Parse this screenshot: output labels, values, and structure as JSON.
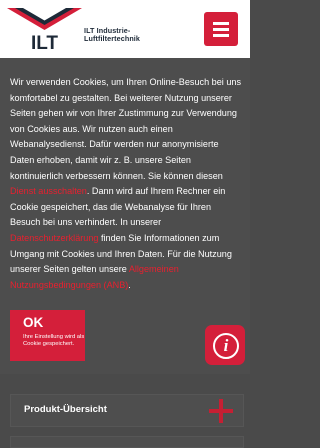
{
  "header": {
    "brand_line1": "ILT Industrie-",
    "brand_line2": "Luftfiltertechnik",
    "logo_letters": "ILT"
  },
  "cookie": {
    "text_1": "Wir verwenden Cookies, um Ihren Online-Besuch bei uns komfortabel zu gestalten. Bei weiterer Nutzung unserer Seiten gehen wir von Ihrer Zustimmung zur Verwendung von Cookies aus. Wir nutzen auch einen Webanalysedienst. Dafür werden nur anonymisierte Daten erhoben, damit wir z. B. unsere Seiten kontinuierlich verbessern können. Sie können diesen ",
    "link_disable": "Dienst ausschalten",
    "text_2": ". Dann wird auf Ihrem Rechner ein Cookie gespeichert, das die Webanalyse für Ihren Besuch bei uns verhindert. In unserer ",
    "link_privacy": "Datenschutzerklärung",
    "text_3": " finden Sie Informationen zum Umgang mit Cookies und Ihren Daten. Für die Nutzung unserer Seiten gelten unsere ",
    "link_terms": "Allgemeinen Nutzungsbedingungen (ANB)",
    "text_4": ".",
    "ok_label": "OK",
    "ok_sub": "Ihre Einstellung wird als Cookie gespeichert."
  },
  "page": {
    "product_overview": "Produkt-Übersicht"
  },
  "colors": {
    "accent": "#d41f3a",
    "overlay": "#4d4d4d",
    "link": "#e8202f"
  },
  "icons": {
    "menu": "hamburger-icon",
    "info": "info-icon",
    "expand": "plus-icon"
  }
}
